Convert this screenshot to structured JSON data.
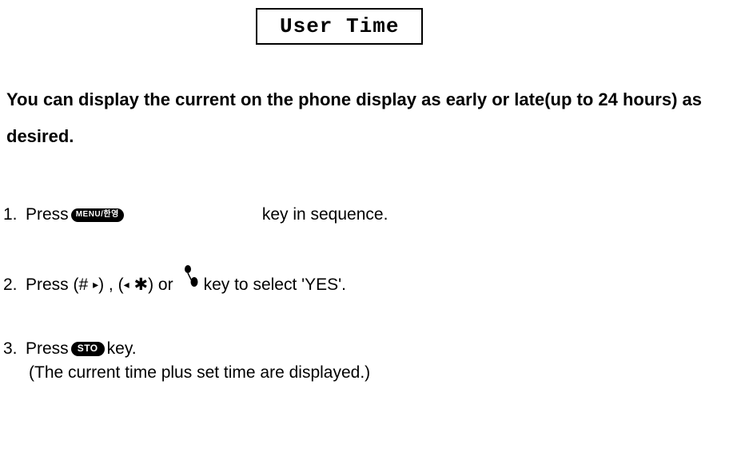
{
  "title": "User Time",
  "intro": "You can display the current on the phone display as early or late(up to 24 hours) as desired.",
  "steps": {
    "s1": {
      "num": "1.",
      "press": "Press",
      "button_label": "MENU/한영",
      "after": "key in sequence."
    },
    "s2": {
      "num": "2.",
      "press": "Press",
      "group1_open": "(#",
      "arrow_right": "▸",
      "group1_close": ") , (",
      "arrow_left": "◂",
      "star": "✱",
      "group2_close": ") or",
      "after": "key to select 'YES'."
    },
    "s3": {
      "num": "3.",
      "press": "Press",
      "button_label": "STO",
      "after": "key.",
      "detail": "(The current time plus set time are displayed.)"
    }
  }
}
